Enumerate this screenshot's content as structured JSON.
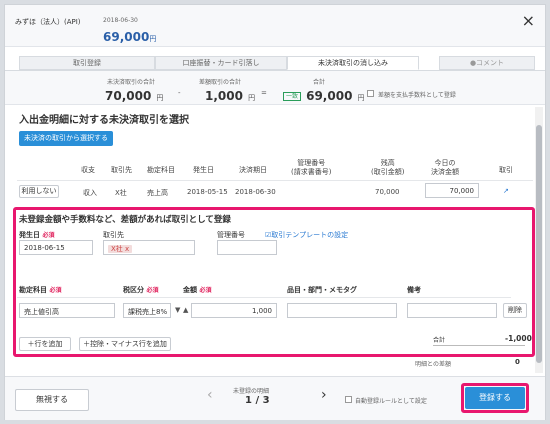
{
  "header": {
    "company": "みずほ（法人）(API)",
    "date": "2018-06-30",
    "amount": "69,000",
    "yen": "円",
    "close": "×"
  },
  "tabs": [
    {
      "label": "取引登録"
    },
    {
      "label": "口座振替・カード引落し"
    },
    {
      "label": "未決済取引の消し込み"
    },
    {
      "label": "コメント"
    }
  ],
  "summary": {
    "unsettled_label": "未決済取引の合計",
    "unsettled_value": "70,000",
    "diff_label": "差額取引の合計",
    "diff_value": "1,000",
    "total_label": "合計",
    "total_badge": "一致",
    "total_value": "69,000",
    "yen": "円",
    "minus": "-",
    "equals": "=",
    "checkbox_label": "差額を支払手数料として登録"
  },
  "section1": {
    "title": "入出金明細に対する未決済取引を選択",
    "select_button": "未決済の取引から選択する",
    "columns": [
      "収支",
      "取引先",
      "勘定科目",
      "発生日",
      "決済期日",
      "管理番号\n(請求書番号)",
      "残高\n(取引金額)",
      "今日の\n決済金額",
      "取引"
    ],
    "row": {
      "unuse": "利用しない",
      "type": "収入",
      "partner": "X社",
      "account": "売上高",
      "date": "2018-05-15",
      "due": "2018-06-30",
      "balance": "70,000",
      "amount": "70,000",
      "link_icon": "↗"
    }
  },
  "section2": {
    "title": "未登録金額や手数料など、差額があれば取引として登録",
    "date_label": "発生日",
    "required": "必須",
    "date_value": "2018-06-15",
    "partner_label": "取引先",
    "partner_value": "X社 x",
    "mgmt_label": "管理番号",
    "template_link": "取引テンプレートの設定",
    "account_label": "勘定科目",
    "tax_label": "税区分",
    "amount_label": "金額",
    "item_label": "品目・部門・メモタグ",
    "note_label": "備考",
    "account_value": "売上値引高",
    "tax_value": "課税売上8%",
    "amount_value": "1,000",
    "delete_button": "削除",
    "add_row": "行を追加",
    "add_minus_row": "控除・マイナス行を追加",
    "total_label": "合計",
    "total_value": "-1,000",
    "diff_label": "明細との差額",
    "diff_value": "0"
  },
  "footer": {
    "ignore_button": "無視する",
    "pager_label": "未登録の明細",
    "pager_value": "1 / 3",
    "auto_rule_label": "自動登録ルールとして設定",
    "register_button": "登録する"
  }
}
